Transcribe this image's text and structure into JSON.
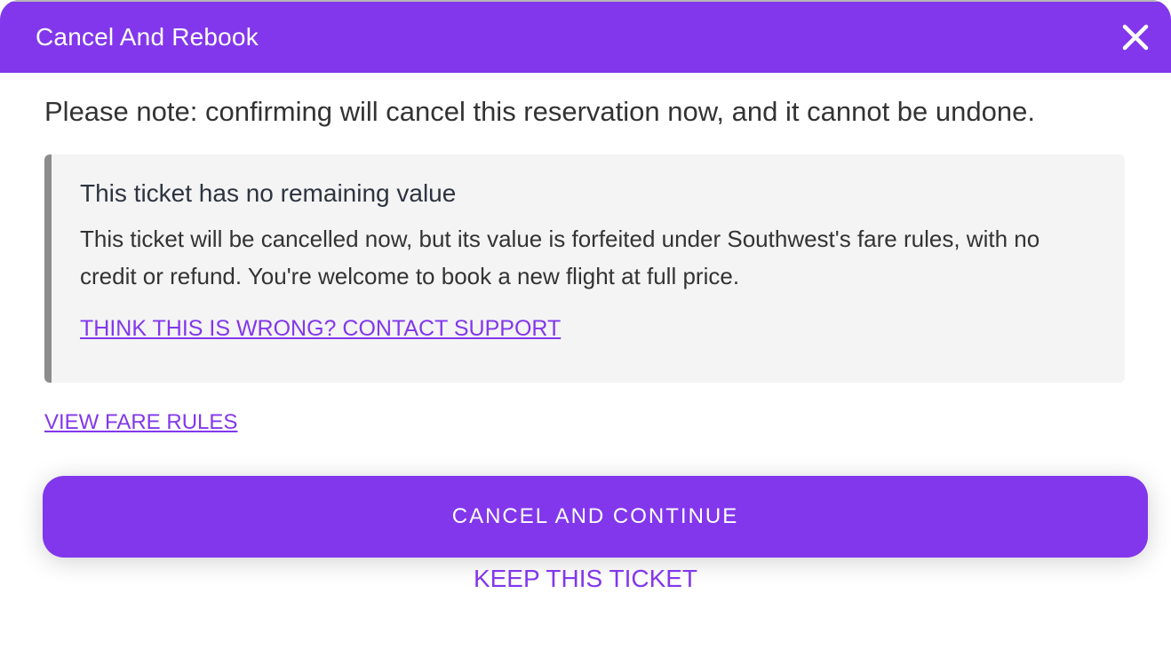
{
  "header": {
    "title": "Cancel And Rebook",
    "close_icon": "close-icon"
  },
  "note": "Please note: confirming will cancel this reservation now, and it cannot be undone.",
  "info_box": {
    "title": "This ticket has no remaining value",
    "body": "This ticket will be cancelled now, but its value is forfeited under Southwest's fare rules, with no credit or refund. You're welcome to book a new flight at full price.",
    "support_link": "THINK THIS IS WRONG? CONTACT SUPPORT"
  },
  "fare_rules_link": "VIEW FARE RULES",
  "actions": {
    "primary_label": "CANCEL AND CONTINUE",
    "secondary_label": "KEEP THIS TICKET"
  },
  "colors": {
    "accent": "#8237ec",
    "info_background": "#f4f4f4",
    "info_border": "#8c8c8c"
  }
}
